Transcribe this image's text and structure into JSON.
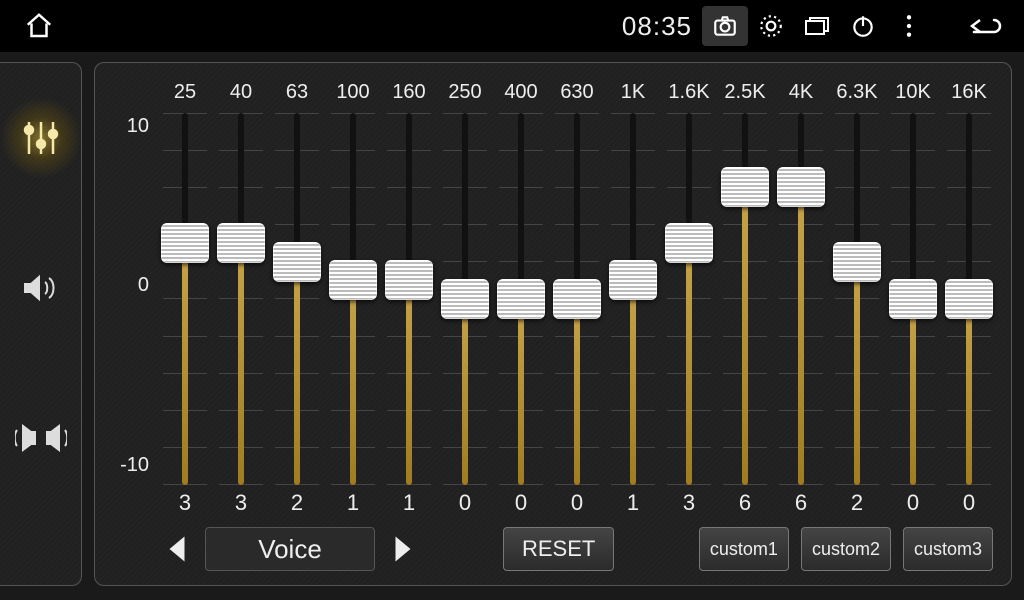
{
  "status": {
    "time": "08:35"
  },
  "sidebar": {
    "items": [
      "eq",
      "volume",
      "balance"
    ],
    "active_index": 0
  },
  "eq": {
    "y_max_label": "10",
    "y_mid_label": "0",
    "y_min_label": "-10",
    "range_min": -10,
    "range_max": 10,
    "bands": [
      {
        "freq": "25",
        "value": 3
      },
      {
        "freq": "40",
        "value": 3
      },
      {
        "freq": "63",
        "value": 2
      },
      {
        "freq": "100",
        "value": 1
      },
      {
        "freq": "160",
        "value": 1
      },
      {
        "freq": "250",
        "value": 0
      },
      {
        "freq": "400",
        "value": 0
      },
      {
        "freq": "630",
        "value": 0
      },
      {
        "freq": "1K",
        "value": 1
      },
      {
        "freq": "1.6K",
        "value": 3
      },
      {
        "freq": "2.5K",
        "value": 6
      },
      {
        "freq": "4K",
        "value": 6
      },
      {
        "freq": "6.3K",
        "value": 2
      },
      {
        "freq": "10K",
        "value": 0
      },
      {
        "freq": "16K",
        "value": 0
      }
    ]
  },
  "controls": {
    "preset_label": "Voice",
    "reset_label": "RESET",
    "custom_labels": [
      "custom1",
      "custom2",
      "custom3"
    ]
  }
}
